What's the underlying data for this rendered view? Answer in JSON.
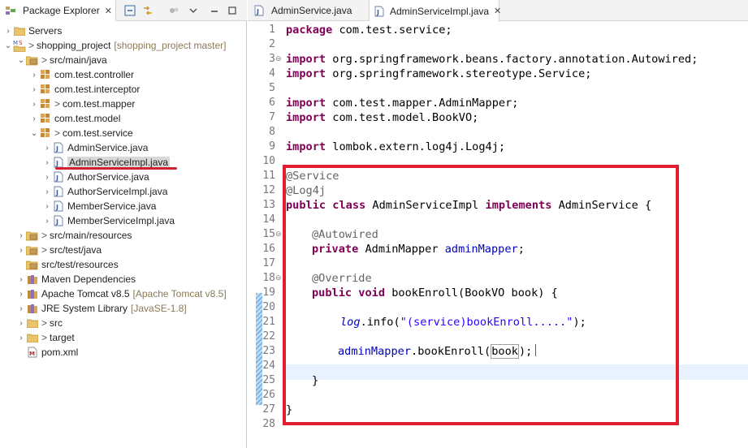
{
  "explorer": {
    "tab_title": "Package Explorer",
    "close_symbol": "✕",
    "tree": [
      {
        "label": "Servers",
        "deco": ""
      },
      {
        "label": "shopping_project",
        "prefix": ">",
        "deco": "[shopping_project master]"
      },
      {
        "label": "src/main/java",
        "prefix": ">"
      },
      {
        "label": "com.test.controller"
      },
      {
        "label": "com.test.interceptor"
      },
      {
        "label": "com.test.mapper",
        "prefix": ">"
      },
      {
        "label": "com.test.model"
      },
      {
        "label": "com.test.service",
        "prefix": ">"
      },
      {
        "label": "AdminService.java"
      },
      {
        "label": "AdminServiceImpl.java"
      },
      {
        "label": "AuthorService.java"
      },
      {
        "label": "AuthorServiceImpl.java"
      },
      {
        "label": "MemberService.java"
      },
      {
        "label": "MemberServiceImpl.java"
      },
      {
        "label": "src/main/resources",
        "prefix": ">"
      },
      {
        "label": "src/test/java",
        "prefix": ">"
      },
      {
        "label": "src/test/resources"
      },
      {
        "label": "Maven Dependencies"
      },
      {
        "label": "Apache Tomcat v8.5",
        "deco": "[Apache Tomcat v8.5]"
      },
      {
        "label": "JRE System Library",
        "deco": "[JavaSE-1.8]"
      },
      {
        "label": "src",
        "prefix": ">"
      },
      {
        "label": "target",
        "prefix": ">"
      },
      {
        "label": "pom.xml"
      }
    ]
  },
  "editor": {
    "tabs": [
      {
        "label": "AdminService.java"
      },
      {
        "label": "AdminServiceImpl.java",
        "close": "✕"
      }
    ],
    "line_numbers": [
      "1",
      "2",
      "3",
      "4",
      "5",
      "6",
      "7",
      "8",
      "9",
      "10",
      "11",
      "12",
      "13",
      "14",
      "15",
      "16",
      "17",
      "18",
      "19",
      "20",
      "21",
      "22",
      "23",
      "24",
      "25",
      "26",
      "27",
      "28"
    ],
    "code": {
      "l1_kw": "package",
      "l1_rest": " com.test.service;",
      "l3_kw": "import",
      "l3_rest": " org.springframework.beans.factory.annotation.Autowired;",
      "l4_kw": "import",
      "l4_rest": " org.springframework.stereotype.Service;",
      "l6_kw": "import",
      "l6_rest": " com.test.mapper.AdminMapper;",
      "l7_kw": "import",
      "l7_rest": " com.test.model.BookVO;",
      "l9_kw": "import",
      "l9_rest": " lombok.extern.log4j.Log4j;",
      "l11": "@Service",
      "l12": "@Log4j",
      "l13_kw1": "public class",
      "l13_mid": " AdminServiceImpl ",
      "l13_kw2": "implements",
      "l13_rest": " AdminService {",
      "l15": "@Autowired",
      "l16_kw": "private",
      "l16_type": " AdminMapper ",
      "l16_fld": "adminMapper",
      "l16_end": ";",
      "l18": "@Override",
      "l19_kw": "public void",
      "l19_rest": " bookEnroll(BookVO book) {",
      "l21_log": "log",
      "l21_mid": ".info(",
      "l21_str": "\"(service)bookEnroll.....\"",
      "l21_end": ");",
      "l23_fld": "adminMapper",
      "l23_mid": ".bookEnroll(",
      "l23_arg": "book",
      "l23_end": ");",
      "l25": "}",
      "l27": "}"
    }
  },
  "colors": {
    "highlight_box": "#e0202e",
    "keyword": "#7f0055",
    "annotation": "#646464",
    "field": "#0000c0",
    "string": "#2a00ff"
  }
}
